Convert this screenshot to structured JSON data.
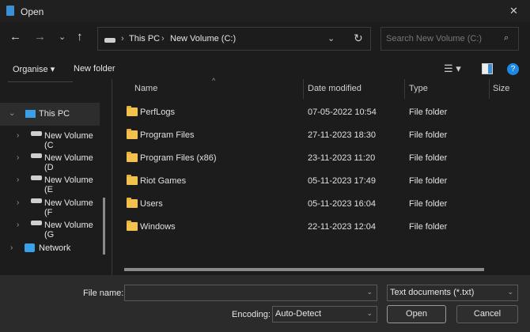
{
  "window": {
    "title": "Open",
    "close": "✕"
  },
  "nav": {
    "back": "←",
    "forward": "→",
    "recent": "⌄",
    "up": "↑",
    "breadcrumb": [
      "This PC",
      "New Volume (C:)"
    ],
    "search_placeholder": "Search New Volume (C:)"
  },
  "toolbar": {
    "organise": "Organise ▾",
    "new_folder": "New folder",
    "help": "?"
  },
  "columns": {
    "name": "Name",
    "date": "Date modified",
    "type": "Type",
    "size": "Size"
  },
  "files": [
    {
      "name": "PerfLogs",
      "date": "07-05-2022 10:54",
      "type": "File folder"
    },
    {
      "name": "Program Files",
      "date": "27-11-2023 18:30",
      "type": "File folder"
    },
    {
      "name": "Program Files (x86)",
      "date": "23-11-2023 11:20",
      "type": "File folder"
    },
    {
      "name": "Riot Games",
      "date": "05-11-2023 17:49",
      "type": "File folder"
    },
    {
      "name": "Users",
      "date": "05-11-2023 16:04",
      "type": "File folder"
    },
    {
      "name": "Windows",
      "date": "22-11-2023 12:04",
      "type": "File folder"
    }
  ],
  "sidebar": {
    "this_pc": "This PC",
    "drives": [
      "New Volume (C",
      "New Volume (D",
      "New Volume (E",
      "New Volume (F",
      "New Volume (G"
    ],
    "network": "Network"
  },
  "footer": {
    "file_name_label": "File name:",
    "file_name_value": "",
    "file_type": "Text documents (*.txt)",
    "encoding_label": "Encoding:",
    "encoding": "Auto-Detect",
    "open": "Open",
    "cancel": "Cancel"
  }
}
